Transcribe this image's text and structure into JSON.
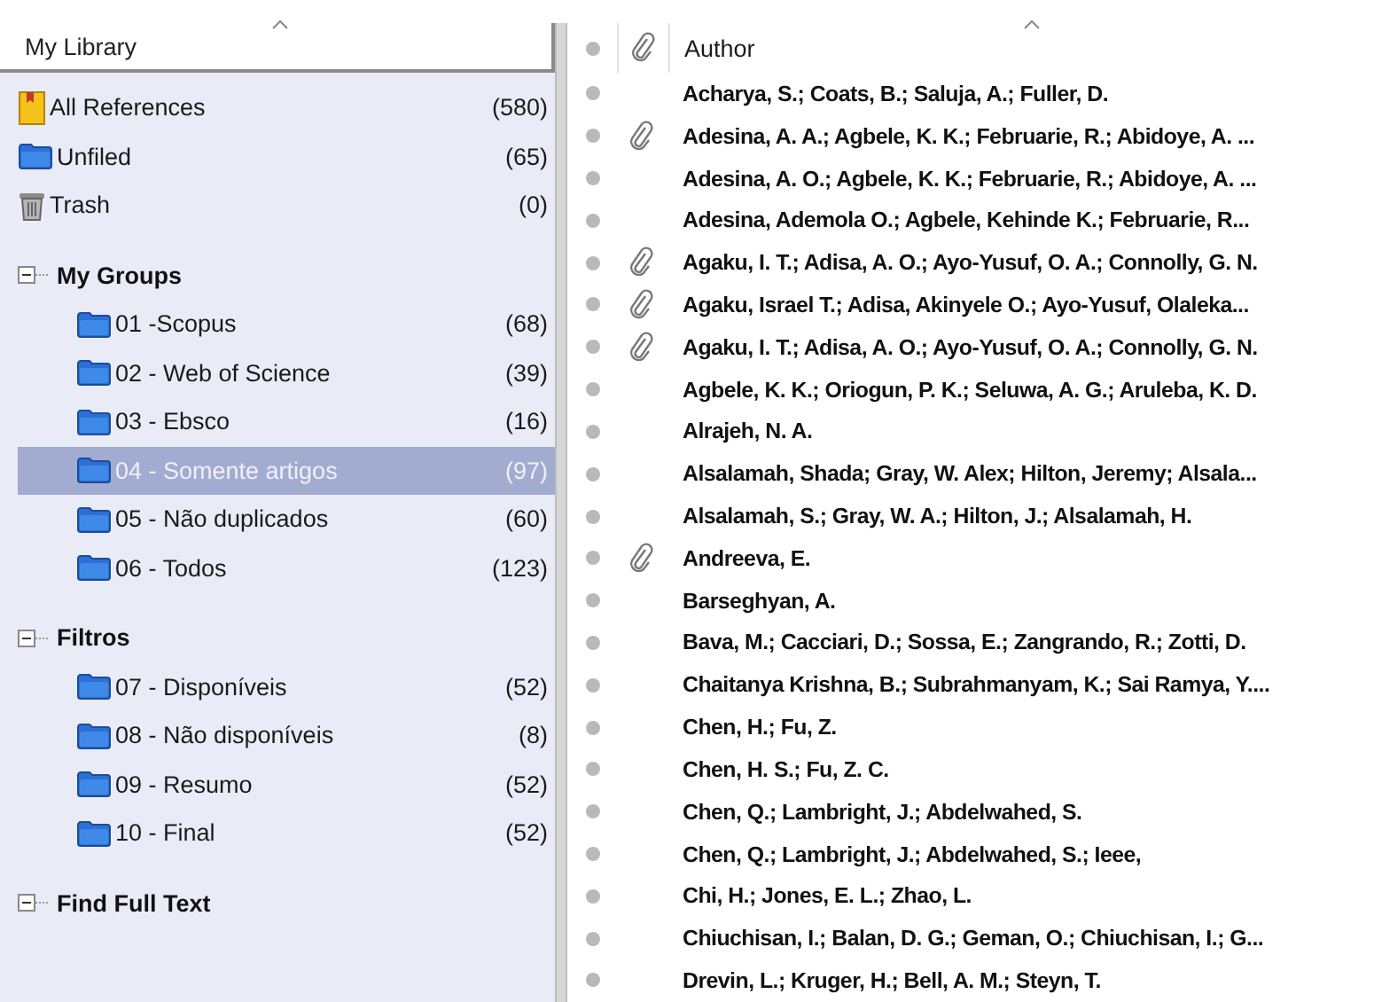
{
  "library": {
    "header": "My Library",
    "items": [
      {
        "kind": "all",
        "label": "All References",
        "count": "(580)",
        "selected": false
      },
      {
        "kind": "unfiled",
        "label": "Unfiled",
        "count": "(65)",
        "selected": false
      },
      {
        "kind": "trash",
        "label": "Trash",
        "count": "(0)",
        "selected": false
      }
    ],
    "groups": [
      {
        "title": "My Groups",
        "expanded": true,
        "children": [
          {
            "label": "01 -Scopus",
            "count": "(68)",
            "selected": false
          },
          {
            "label": "02 - Web of Science",
            "count": "(39)",
            "selected": false
          },
          {
            "label": "03 - Ebsco",
            "count": "(16)",
            "selected": false
          },
          {
            "label": "04 - Somente artigos",
            "count": "(97)",
            "selected": true
          },
          {
            "label": "05 - Não duplicados",
            "count": "(60)",
            "selected": false
          },
          {
            "label": "06 - Todos",
            "count": "(123)",
            "selected": false
          }
        ]
      },
      {
        "title": "Filtros",
        "expanded": true,
        "children": [
          {
            "label": "07 - Disponíveis",
            "count": "(52)",
            "selected": false
          },
          {
            "label": "08 - Não disponíveis",
            "count": "(8)",
            "selected": false
          },
          {
            "label": "09 - Resumo",
            "count": "(52)",
            "selected": false
          },
          {
            "label": "10 - Final",
            "count": "(52)",
            "selected": false
          }
        ]
      },
      {
        "title": "Find Full Text",
        "expanded": true
      }
    ]
  },
  "references": {
    "author_column": "Author",
    "rows": [
      {
        "author": "Acharya, S.; Coats, B.; Saluja, A.; Fuller, D.",
        "attachment": false
      },
      {
        "author": "Adesina, A. A.; Agbele, K. K.; Februarie, R.; Abidoye, A. ...",
        "attachment": true
      },
      {
        "author": "Adesina, A. O.; Agbele, K. K.; Februarie, R.; Abidoye, A. ...",
        "attachment": false
      },
      {
        "author": "Adesina, Ademola O.; Agbele, Kehinde K.; Februarie, R...",
        "attachment": false
      },
      {
        "author": "Agaku, I. T.; Adisa, A. O.; Ayo-Yusuf, O. A.; Connolly, G. N.",
        "attachment": true
      },
      {
        "author": "Agaku, Israel T.; Adisa, Akinyele O.; Ayo-Yusuf, Olaleka...",
        "attachment": true
      },
      {
        "author": "Agaku, I. T.; Adisa, A. O.; Ayo-Yusuf, O. A.; Connolly, G. N.",
        "attachment": true
      },
      {
        "author": "Agbele, K. K.; Oriogun, P. K.; Seluwa, A. G.; Aruleba, K. D.",
        "attachment": false
      },
      {
        "author": "Alrajeh, N. A.",
        "attachment": false
      },
      {
        "author": "Alsalamah, Shada; Gray, W. Alex; Hilton, Jeremy; Alsala...",
        "attachment": false
      },
      {
        "author": "Alsalamah, S.; Gray, W. A.; Hilton, J.; Alsalamah, H.",
        "attachment": false
      },
      {
        "author": "Andreeva, E.",
        "attachment": true
      },
      {
        "author": "Barseghyan, A.",
        "attachment": false
      },
      {
        "author": "Bava, M.; Cacciari, D.; Sossa, E.; Zangrando, R.; Zotti, D.",
        "attachment": false
      },
      {
        "author": "Chaitanya Krishna, B.; Subrahmanyam, K.; Sai Ramya, Y....",
        "attachment": false
      },
      {
        "author": "Chen, H.; Fu, Z.",
        "attachment": false
      },
      {
        "author": "Chen, H. S.; Fu, Z. C.",
        "attachment": false
      },
      {
        "author": "Chen, Q.; Lambright, J.; Abdelwahed, S.",
        "attachment": false
      },
      {
        "author": "Chen, Q.; Lambright, J.; Abdelwahed, S.; Ieee,",
        "attachment": false
      },
      {
        "author": "Chi, H.; Jones, E. L.; Zhao, L.",
        "attachment": false
      },
      {
        "author": "Chiuchisan, I.; Balan, D. G.; Geman, O.; Chiuchisan, I.; G...",
        "attachment": false
      },
      {
        "author": "Drevin, L.; Kruger, H.; Bell, A. M.; Steyn, T.",
        "attachment": false
      }
    ]
  }
}
